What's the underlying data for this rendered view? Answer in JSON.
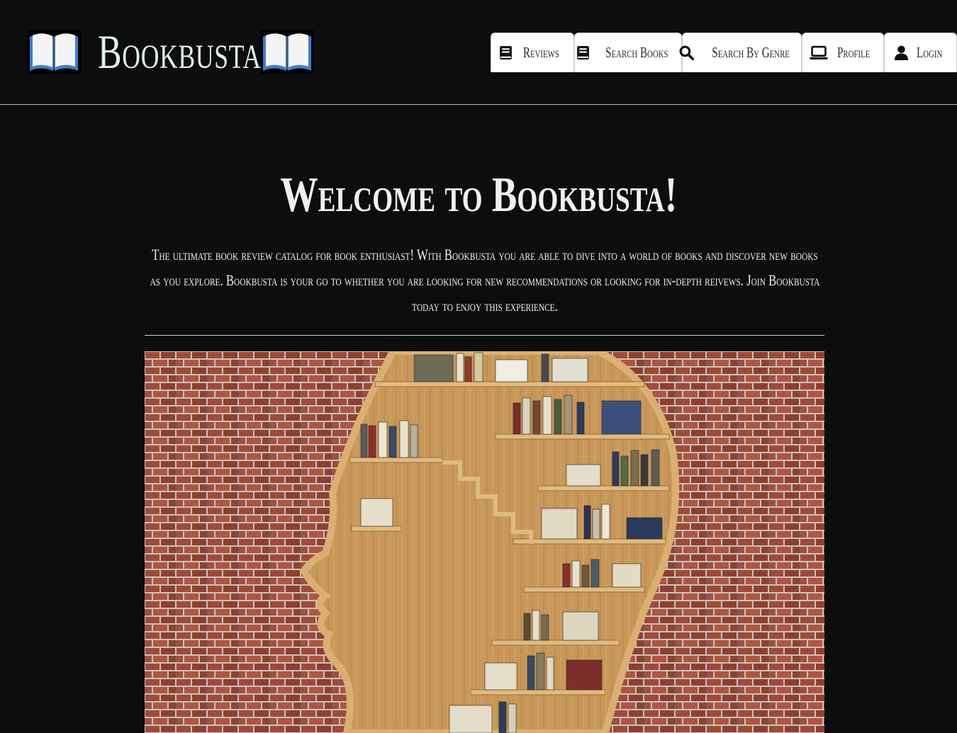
{
  "brand": {
    "name": "Bookbusta",
    "icon_left": "open-book-icon",
    "icon_right": "open-book-icon"
  },
  "nav": [
    {
      "label": "Reviews",
      "icon": "book-icon"
    },
    {
      "label": "Search Books",
      "icon": "book-icon"
    },
    {
      "label": "Search By Genre",
      "icon": "search-icon"
    },
    {
      "label": "Profile",
      "icon": "laptop-icon"
    },
    {
      "label": "Login",
      "icon": "user-icon"
    }
  ],
  "main": {
    "title": "Welcome to Bookbusta!",
    "intro": "The ultimate book review catalog for book enthusiast! With Bookbusta you are able to dive into a world of books and discover new books as you explore. Bookbusta is your go to whether you are looking for new recommendations or looking for in-depth reivews. Join Bookbusta today to enjoy this experience."
  },
  "colors": {
    "background": "#0d0d0d",
    "nav_background": "#ffffff",
    "brand_text": "#dff1ea",
    "brick": "#9a4a36",
    "wood": "#c99a5c"
  }
}
